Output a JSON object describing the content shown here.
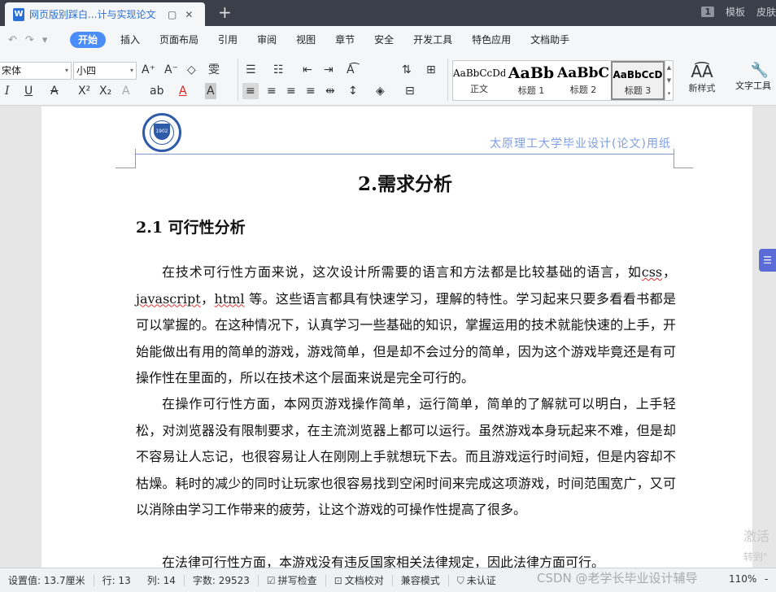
{
  "titlebar": {
    "doc_tab_title": "网页版别踩白...计与实现论文",
    "doc_icon_letter": "W",
    "tab_restore": "▢",
    "tab_close": "✕",
    "new_tab": "+",
    "badge": "1",
    "skin_label": "模板",
    "skin2_label": "皮肤"
  },
  "menubar": {
    "quick": [
      "↶",
      "↷",
      "▾"
    ],
    "items": [
      "开始",
      "插入",
      "页面布局",
      "引用",
      "审阅",
      "视图",
      "章节",
      "安全",
      "开发工具",
      "特色应用",
      "文档助手"
    ]
  },
  "ribbon": {
    "font_name": "宋体",
    "font_size": "小四",
    "font_size_arrow": "▾",
    "font_arrow": "▾",
    "styles": [
      {
        "sample": "AaBbCcDd",
        "name": "正文"
      },
      {
        "sample": "AaBb",
        "name": "标题 1"
      },
      {
        "sample": "AaBbC",
        "name": "标题 2"
      },
      {
        "sample": "AaBbCcD",
        "name": "标题 3"
      }
    ],
    "new_style_label": "新样式",
    "new_style_icon": "A͡A",
    "text_tool_label": "文字工具",
    "text_tool_icon": "🔧",
    "row1_icons": [
      "A⁺",
      "A⁻",
      "◇",
      "雯",
      "☰",
      "☷",
      "⇤",
      "⇥",
      "A͡",
      "⇅",
      "⊞"
    ],
    "row2_icons": [
      "I",
      "U",
      "A",
      "X²",
      "X₂",
      "A",
      "ab",
      "A",
      "A",
      "≡",
      "≡",
      "≡",
      "≡",
      "⇹",
      "↕",
      "◈",
      "⊟"
    ]
  },
  "document": {
    "running_head": "太原理工大学毕业设计(论文)用纸",
    "logo_text": "1902",
    "chapter_title": "2.需求分析",
    "section_title": "2.1  可行性分析",
    "para1_a": "在技术可行性方面来说，这次设计所需要的语言和方法都是比较基础的语言，如",
    "para1_css": "css",
    "para1_sep1": "，",
    "para1_js": "javascript",
    "para1_sep2": "，",
    "para1_html": "html",
    "para1_b": " 等。这些语言都具有快速学习，理解的特性。学习起来只要多看看书都是可以掌握的。在这种情况下，认真学习一些基础的知识，掌握运用的技术就能快速的上手，开始能做出有用的简单的游戏，游戏简单，但是却不会过分的简单，因为这个游戏毕竟还是有可操作性在里面的，所以在技术这个层面来说是完全可行的。",
    "para2": "在操作可行性方面，本网页游戏操作简单，运行简单，简单的了解就可以明白，上手轻松，对浏览器没有限制要求，在主流浏览器上都可以运行。虽然游戏本身玩起来不难，但是却不容易让人忘记，也很容易让人在刚刚上手就想玩下去。而且游戏运行时间短，但是内容却不枯燥。耗时的减少的同时让玩家也很容易找到空闲时间来完成这项游戏，时间范围宽广，又可以消除由学习工作带来的疲劳，让这个游戏的可操作性提高了很多。",
    "para3": "在法律可行性方面，本游戏没有违反国家相关法律规定，因此法律方面可行。"
  },
  "side_tab_icon": "☰",
  "watermark": {
    "line1": "激活",
    "line2": "转到\""
  },
  "statusbar": {
    "setting": "设置值: 13.7厘米",
    "row": "行: 13",
    "col": "列: 14",
    "words": "字数: 29523",
    "spell_check": "拼写检查",
    "doc_check": "文档校对",
    "compat": "兼容模式",
    "uncert": "未认证",
    "csdn": "CSDN @老学长毕业设计辅导",
    "zoom": "110%",
    "zoom_minus": "-"
  }
}
